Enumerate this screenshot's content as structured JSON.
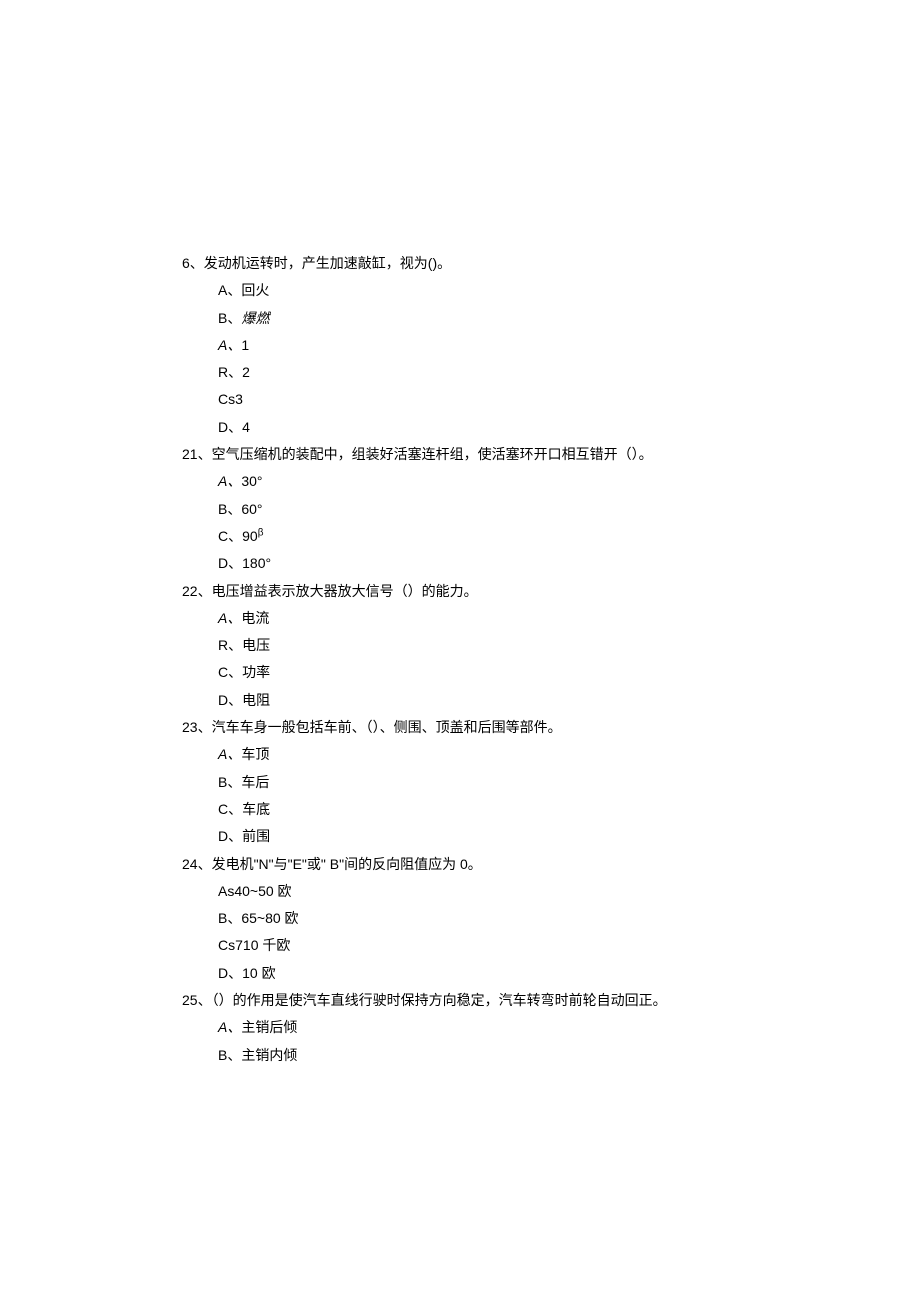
{
  "questions": [
    {
      "num": "6、",
      "text": "发动机运转时，产生加速敲缸，视为()。",
      "options": [
        {
          "label": "A、",
          "text": "回火"
        },
        {
          "label": "B、",
          "text": "爆燃",
          "italic": true
        },
        {
          "label": "A、",
          "text": "1",
          "italic_label": true
        },
        {
          "label": "R、",
          "text": "2"
        },
        {
          "label": "Cs",
          "text": "3"
        },
        {
          "label": "D、",
          "text": "4"
        }
      ]
    },
    {
      "num": "21、",
      "text": "空气压缩机的装配中，组装好活塞连杆组，使活塞环开口相互错开（）。",
      "options": [
        {
          "label": "A、",
          "text": "30°",
          "italic_label": true
        },
        {
          "label": "B、",
          "text": "60°"
        },
        {
          "label": "C、",
          "text": "90",
          "sup": "β"
        },
        {
          "label": "D、",
          "text": "180°"
        }
      ]
    },
    {
      "num": "22、",
      "text": "电压增益表示放大器放大信号（）的能力。",
      "options": [
        {
          "label": "A、",
          "text": "电流",
          "italic_label": true
        },
        {
          "label": "R、",
          "text": "电压"
        },
        {
          "label": "C、",
          "text": "功率"
        },
        {
          "label": "D、",
          "text": "电阻"
        }
      ]
    },
    {
      "num": "23、",
      "text": "汽车车身一般包括车前、（）、侧围、顶盖和后围等部件。",
      "options": [
        {
          "label": "A、",
          "text": "车顶",
          "italic_label": true
        },
        {
          "label": "B、",
          "text": "车后"
        },
        {
          "label": "C、",
          "text": "车底"
        },
        {
          "label": "D、",
          "text": "前围"
        }
      ]
    },
    {
      "num": "24、",
      "text": "发电机\"N\"与\"E\"或\" B\"间的反向阻值应为 0。",
      "options": [
        {
          "label": "As",
          "text": "40~50 欧"
        },
        {
          "label": "B、",
          "text": "65~80 欧"
        },
        {
          "label": "Cs",
          "text": "710 千欧"
        },
        {
          "label": "D、",
          "text": "10 欧"
        }
      ]
    },
    {
      "num": "25、",
      "text": "（）的作用是使汽车直线行驶时保持方向稳定，汽车转弯时前轮自动回正。",
      "options": [
        {
          "label": "A、",
          "text": "主销后倾",
          "italic_label": true
        },
        {
          "label": "B、",
          "text": "主销内倾"
        }
      ]
    }
  ]
}
